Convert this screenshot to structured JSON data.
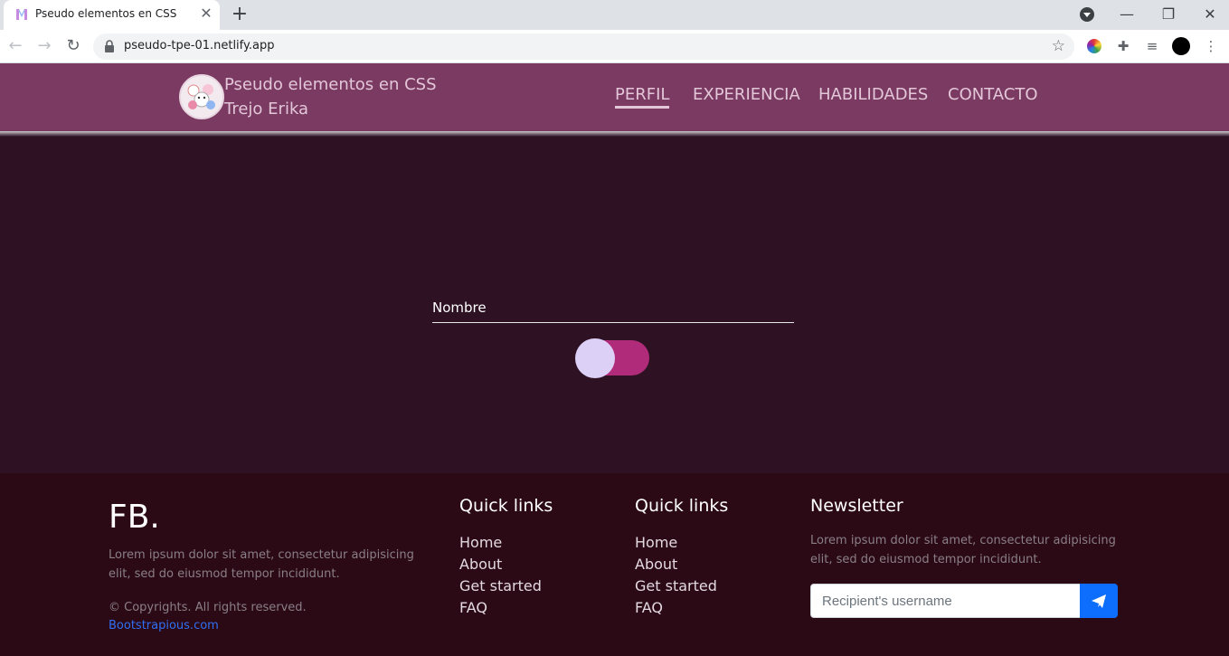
{
  "browser": {
    "tab_title": "Pseudo elementos en CSS",
    "url": "pseudo-tpe-01.netlify.app"
  },
  "header": {
    "brand_line1": "Pseudo elementos en CSS",
    "brand_line2": "Trejo Erika",
    "nav": [
      "PERFIL",
      "EXPERIENCIA",
      "HABILIDADES",
      "CONTACTO"
    ],
    "active_nav": "PERFIL"
  },
  "main": {
    "name_label": "Nombre",
    "toggle_on": true
  },
  "footer": {
    "logo": "FB.",
    "description": "Lorem ipsum dolor sit amet, consectetur adipisicing elit, sed do eiusmod tempor incididunt.",
    "copyright": "© Copyrights. All rights reserved.",
    "credit_link": "Bootstrapious.com",
    "col1": {
      "title": "Quick links",
      "links": [
        "Home",
        "About",
        "Get started",
        "FAQ"
      ]
    },
    "col2": {
      "title": "Quick links",
      "links": [
        "Home",
        "About",
        "Get started",
        "FAQ"
      ]
    },
    "newsletter": {
      "title": "Newsletter",
      "description": "Lorem ipsum dolor sit amet, consectetur adipisicing elit, sed do eiusmod tempor incididunt.",
      "placeholder": "Recipient's username"
    }
  },
  "colors": {
    "header_bg": "#7a3a62",
    "main_bg": "#2e1224",
    "footer_bg": "#2b0a16",
    "toggle_track": "#b02b7a",
    "toggle_knob": "#dcd0f7",
    "button_blue": "#0d6efd"
  }
}
